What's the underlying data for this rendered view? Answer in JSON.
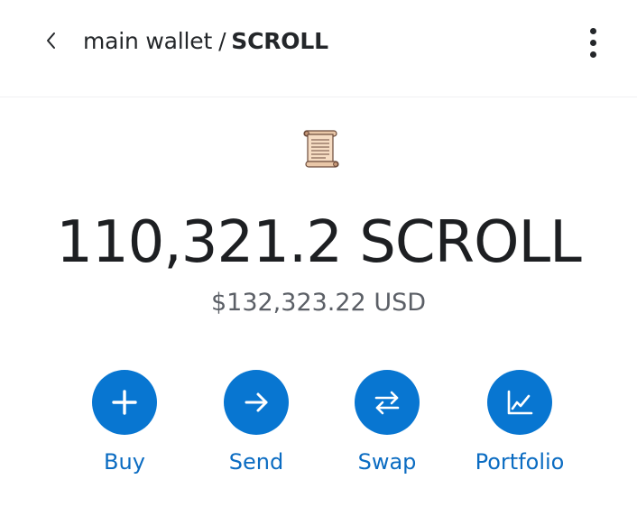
{
  "header": {
    "wallet_name": "main wallet",
    "separator": "/",
    "token_symbol": "SCROLL",
    "back_icon": "chevron-left-icon",
    "more_icon": "vertical-dots-icon"
  },
  "token": {
    "icon": "scroll-icon",
    "balance": "110,321.2 SCROLL",
    "fiat_value": "$132,323.22 USD"
  },
  "actions": [
    {
      "label": "Buy",
      "icon": "plus-icon"
    },
    {
      "label": "Send",
      "icon": "arrow-right-icon"
    },
    {
      "label": "Swap",
      "icon": "swap-arrows-icon"
    },
    {
      "label": "Portfolio",
      "icon": "chart-line-icon"
    }
  ],
  "colors": {
    "accent": "#0876d1",
    "accent_text": "#0b6cc2",
    "text_primary": "#24272a",
    "text_secondary": "#5b5f66"
  }
}
